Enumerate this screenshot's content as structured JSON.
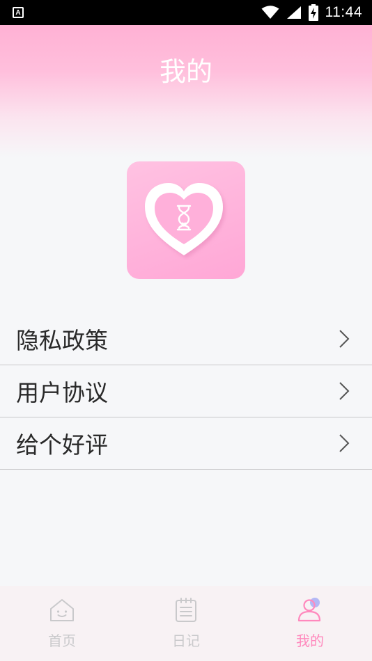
{
  "status_bar": {
    "time": "11:44",
    "notification_glyph": "A",
    "icons": [
      "notification-icon",
      "wifi-icon",
      "signal-icon",
      "battery-charging-icon"
    ]
  },
  "header": {
    "title": "我的"
  },
  "logo": {
    "icon": "heart-hourglass-icon",
    "colors": {
      "bg_top": "#ffc2e2",
      "bg_bottom": "#ffa7d6"
    }
  },
  "menu": {
    "items": [
      {
        "label": "隐私政策",
        "icon": "chevron-right-icon"
      },
      {
        "label": "用户协议",
        "icon": "chevron-right-icon"
      },
      {
        "label": "给个好评",
        "icon": "chevron-right-icon"
      }
    ]
  },
  "tab_bar": {
    "tabs": [
      {
        "label": "首页",
        "icon": "home-icon",
        "active": false
      },
      {
        "label": "日记",
        "icon": "diary-icon",
        "active": false
      },
      {
        "label": "我的",
        "icon": "profile-icon",
        "active": true
      }
    ]
  },
  "colors": {
    "accent": "#ff89bd",
    "header_pink": "#ffb1d4",
    "inactive": "#c9c9cb",
    "background": "#f6f7f9"
  }
}
